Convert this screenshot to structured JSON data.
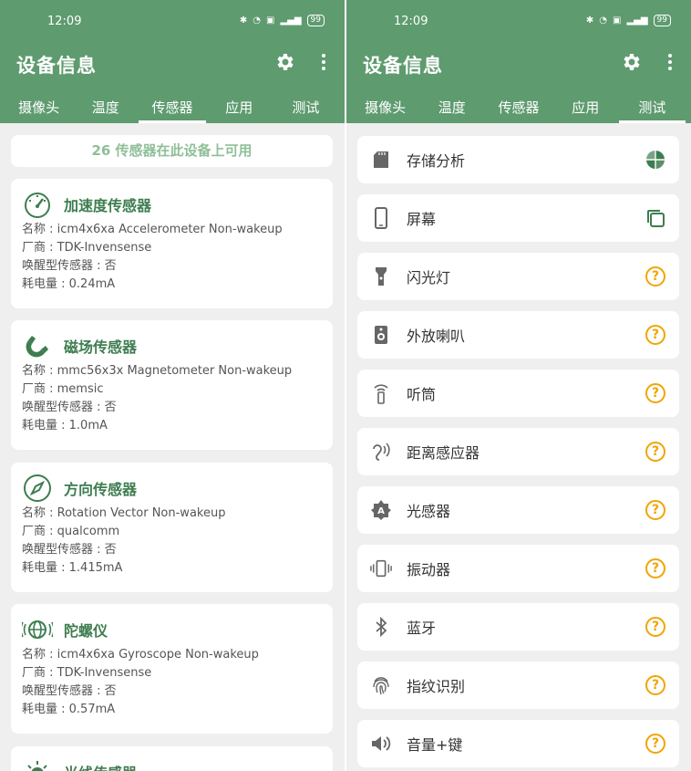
{
  "status_bar": {
    "time": "12:09",
    "battery": "99"
  },
  "app": {
    "title": "设备信息"
  },
  "tabs": [
    "摄像头",
    "温度",
    "传感器",
    "应用",
    "测试"
  ],
  "left": {
    "banner": "26 传感器在此设备上可用",
    "sensors": [
      {
        "title": "加速度传感器",
        "icon": "speedometer-icon",
        "name": "名称 : icm4x6xa Accelerometer Non-wakeup",
        "vendor": "厂商 : TDK-Invensense",
        "wakeup": "唤醒型传感器 : 否",
        "power": "耗电量 : 0.24mA"
      },
      {
        "title": "磁场传感器",
        "icon": "magnet-icon",
        "name": "名称 : mmc56x3x Magnetometer Non-wakeup",
        "vendor": "厂商 : memsic",
        "wakeup": "唤醒型传感器 : 否",
        "power": "耗电量 : 1.0mA"
      },
      {
        "title": "方向传感器",
        "icon": "compass-icon",
        "name": "名称 : Rotation Vector  Non-wakeup",
        "vendor": "厂商 : qualcomm",
        "wakeup": "唤醒型传感器 : 否",
        "power": "耗电量 : 1.415mA"
      },
      {
        "title": "陀螺仪",
        "icon": "gyroscope-icon",
        "name": "名称 : icm4x6xa Gyroscope Non-wakeup",
        "vendor": "厂商 : TDK-Invensense",
        "wakeup": "唤醒型传感器 : 否",
        "power": "耗电量 : 0.57mA"
      },
      {
        "title": "光线传感器",
        "icon": "light-icon"
      }
    ]
  },
  "right": {
    "tests": [
      {
        "label": "存储分析",
        "icon": "sd-card-icon",
        "status": "pie-chart-icon"
      },
      {
        "label": "屏幕",
        "icon": "phone-icon",
        "status": "copy-icon"
      },
      {
        "label": "闪光灯",
        "icon": "flashlight-icon",
        "status": "?"
      },
      {
        "label": "外放喇叭",
        "icon": "speaker-icon",
        "status": "?"
      },
      {
        "label": "听筒",
        "icon": "earpiece-icon",
        "status": "?"
      },
      {
        "label": "距离感应器",
        "icon": "ear-icon",
        "status": "?"
      },
      {
        "label": "光感器",
        "icon": "brightness-icon",
        "status": "?"
      },
      {
        "label": "振动器",
        "icon": "vibrate-icon",
        "status": "?"
      },
      {
        "label": "蓝牙",
        "icon": "bluetooth-icon",
        "status": "?"
      },
      {
        "label": "指纹识别",
        "icon": "fingerprint-icon",
        "status": "?"
      },
      {
        "label": "音量+键",
        "icon": "volume-icon",
        "status": "?"
      }
    ]
  },
  "colors": {
    "primary": "#5e9b6f",
    "accent_text": "#3e7d50",
    "banner_text": "#8fbf99",
    "warning": "#f0a500"
  }
}
